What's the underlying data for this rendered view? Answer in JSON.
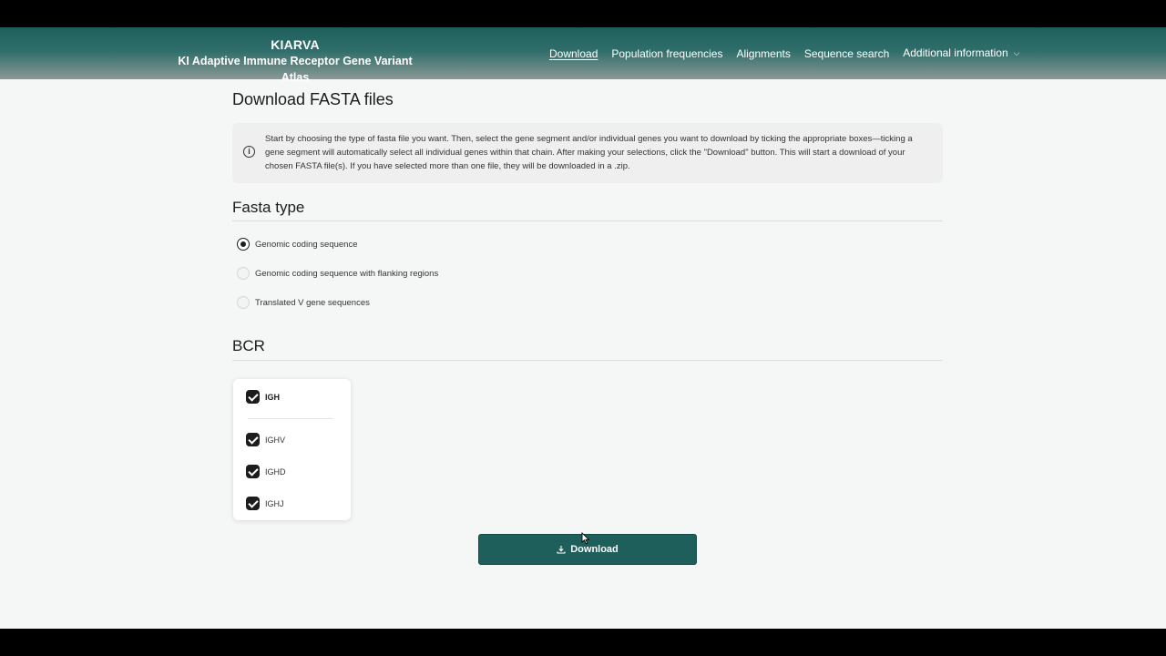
{
  "header": {
    "brand_short": "KIARVA",
    "brand_long": "KI Adaptive Immune Receptor Gene Variant Atlas",
    "nav": [
      {
        "label": "Download",
        "active": true
      },
      {
        "label": "Population frequencies"
      },
      {
        "label": "Alignments"
      },
      {
        "label": "Sequence search"
      },
      {
        "label": "Additional information",
        "has_dropdown": true,
        "icon": "chevron-down-icon"
      }
    ]
  },
  "main": {
    "title": "Download FASTA files",
    "info": {
      "icon": "info-icon",
      "text": "Start by choosing the type of fasta file you want. Then, select the gene segment and/or individual genes you want to download by ticking the appropriate boxes—ticking a gene segment will automatically select all individual genes within that chain. After making your selections, click the \"Download\" button. This will start a download of your chosen FASTA file(s). If you have selected more than one file, they will be downloaded in a .zip."
    },
    "fasta_type": {
      "title": "Fasta type",
      "options": [
        {
          "label": "Genomic coding sequence",
          "selected": true
        },
        {
          "label": "Genomic coding sequence with flanking regions",
          "selected": false
        },
        {
          "label": "Translated V gene sequences",
          "selected": false
        }
      ]
    },
    "bcr": {
      "title": "BCR",
      "chain": {
        "label": "IGH",
        "checked": true
      },
      "genes": [
        {
          "label": "IGHV",
          "checked": true
        },
        {
          "label": "IGHD",
          "checked": true
        },
        {
          "label": "IGHJ",
          "checked": true
        }
      ]
    },
    "download_button": {
      "label": "Download",
      "icon": "download-icon"
    }
  },
  "colors": {
    "header_teal": "#1f5f5b",
    "button_teal": "#1e5f5c",
    "background": "#f5f7f7"
  }
}
